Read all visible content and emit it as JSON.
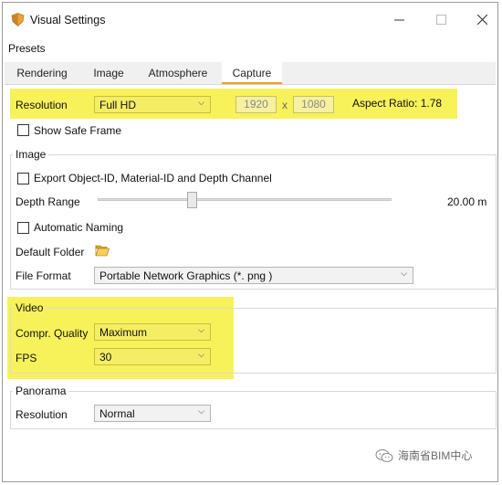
{
  "window": {
    "title": "Visual Settings"
  },
  "menu": {
    "presets": "Presets"
  },
  "tabs": [
    "Rendering",
    "Image",
    "Atmosphere",
    "Capture"
  ],
  "active_tab": "Capture",
  "capture": {
    "resolution_label": "Resolution",
    "resolution_value": "Full HD",
    "width": "1920",
    "x": "x",
    "height": "1080",
    "aspect_ratio": "Aspect Ratio: 1.78",
    "show_safe_frame": "Show Safe Frame"
  },
  "image": {
    "title": "Image",
    "export_label": "Export  Object-ID, Material-ID and Depth Channel",
    "depth_range_label": "Depth Range",
    "depth_range_value": "20.00 m",
    "depth_range_level": 0.32,
    "automatic_naming": "Automatic Naming",
    "default_folder": "Default Folder",
    "file_format_label": "File Format",
    "file_format_value": "Portable Network Graphics  (*. png )"
  },
  "video": {
    "title": "Video",
    "quality_label": "Compr. Quality",
    "quality_value": "Maximum",
    "fps_label": "FPS",
    "fps_value": "30"
  },
  "panorama": {
    "title": "Panorama",
    "resolution_label": "Resolution",
    "resolution_value": "Normal"
  },
  "watermark": "海南省BIM中心",
  "colors": {
    "highlight": "#f7f25a",
    "tab_accent": "#f0a020"
  }
}
